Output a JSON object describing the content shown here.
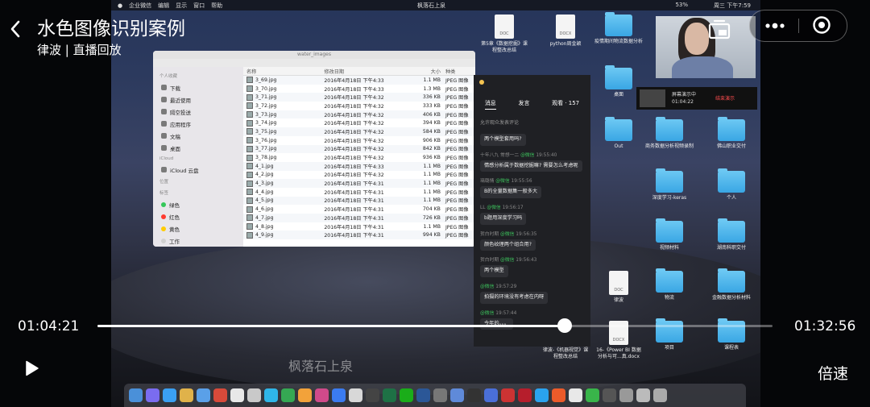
{
  "header": {
    "title": "水色图像识别案例",
    "subtitle": "律波 | 直播回放"
  },
  "player": {
    "current_time": "01:04:21",
    "total_time": "01:32:56",
    "progress": 0.692,
    "speed_label": "倍速"
  },
  "screen": {
    "menubar": {
      "items": [
        "企业微信",
        "编辑",
        "显示",
        "窗口",
        "帮助"
      ],
      "center": "枫落石上泉",
      "battery": "53%",
      "clock": "周三 下午7:59"
    },
    "finder": {
      "window_title": "water_images",
      "sidebar": {
        "favorites_title": "个人收藏",
        "favorites": [
          "下载",
          "最近使用",
          "隔空投送",
          "应用程序",
          "文稿",
          "桌面"
        ],
        "icloud_title": "iCloud",
        "icloud": [
          "iCloud 云盘"
        ],
        "locations_title": "位置",
        "tags_title": "标签",
        "tags": [
          {
            "name": "绿色",
            "color": "#34c759"
          },
          {
            "name": "红色",
            "color": "#ff3b30"
          },
          {
            "name": "黄色",
            "color": "#ffcc00"
          },
          {
            "name": "工作",
            "color": "#d0d0d0"
          }
        ]
      },
      "columns": [
        "名称",
        "修改日期",
        "大小",
        "种类"
      ],
      "rows": [
        [
          "3_69.jpg",
          "2016年4月18日 下午4:33",
          "1.1 MB",
          "JPEG 图像"
        ],
        [
          "3_70.jpg",
          "2016年4月18日 下午4:33",
          "1.3 MB",
          "JPEG 图像"
        ],
        [
          "3_71.jpg",
          "2016年4月18日 下午4:32",
          "336 KB",
          "JPEG 图像"
        ],
        [
          "3_72.jpg",
          "2016年4月18日 下午4:32",
          "333 KB",
          "JPEG 图像"
        ],
        [
          "3_73.jpg",
          "2016年4月18日 下午4:32",
          "406 KB",
          "JPEG 图像"
        ],
        [
          "3_74.jpg",
          "2016年4月18日 下午4:32",
          "394 KB",
          "JPEG 图像"
        ],
        [
          "3_75.jpg",
          "2016年4月18日 下午4:32",
          "584 KB",
          "JPEG 图像"
        ],
        [
          "3_76.jpg",
          "2016年4月18日 下午4:32",
          "906 KB",
          "JPEG 图像"
        ],
        [
          "3_77.jpg",
          "2016年4月18日 下午4:32",
          "842 KB",
          "JPEG 图像"
        ],
        [
          "3_78.jpg",
          "2016年4月18日 下午4:32",
          "936 KB",
          "JPEG 图像"
        ],
        [
          "4_1.jpg",
          "2016年4月18日 下午4:33",
          "1.1 MB",
          "JPEG 图像"
        ],
        [
          "4_2.jpg",
          "2016年4月18日 下午4:32",
          "1.1 MB",
          "JPEG 图像"
        ],
        [
          "4_3.jpg",
          "2016年4月18日 下午4:31",
          "1.1 MB",
          "JPEG 图像"
        ],
        [
          "4_4.jpg",
          "2016年4月18日 下午4:31",
          "1.1 MB",
          "JPEG 图像"
        ],
        [
          "4_5.jpg",
          "2016年4月18日 下午4:31",
          "1.1 MB",
          "JPEG 图像"
        ],
        [
          "4_6.jpg",
          "2016年4月18日 下午4:31",
          "704 KB",
          "JPEG 图像"
        ],
        [
          "4_7.jpg",
          "2016年4月18日 下午4:31",
          "726 KB",
          "JPEG 图像"
        ],
        [
          "4_8.jpg",
          "2016年4月18日 下午4:31",
          "1.1 MB",
          "JPEG 图像"
        ],
        [
          "4_9.jpg",
          "2016年4月18日 下午4:31",
          "994 KB",
          "JPEG 图像"
        ]
      ]
    },
    "chat": {
      "tabs": [
        "消息",
        "发言",
        "观看 · 157"
      ],
      "sort_label": "允许观众发表评论",
      "messages": [
        {
          "user": "",
          "time": "",
          "text": "两个模型套用吗?"
        },
        {
          "user": "十年八九 常想一二",
          "time": "19:55:40",
          "text": "情感分析属于数据挖掘嘛? 需要怎么考虑呢"
        },
        {
          "user": "璃璐情",
          "time": "19:55:56",
          "text": "B的全量数据集一般多大"
        },
        {
          "user": "LL",
          "time": "19:56:17",
          "text": "b题用深度学习吗"
        },
        {
          "user": "贺白时期",
          "time": "19:56:35",
          "text": "颜色纹理两个组合用?"
        },
        {
          "user": "贺白时期",
          "time": "19:56:43",
          "text": "两个模型"
        },
        {
          "user": "",
          "time": "19:57:29",
          "text": "拍摄的环境没有考虑在内呀"
        },
        {
          "user": "",
          "time": "19:57:44",
          "text": "今年的。。。"
        }
      ],
      "wechat_tag": "@微信"
    },
    "share_bar": {
      "label": "屏幕演示中",
      "time": "01:04:22",
      "stop": "结束演示"
    },
    "desktop_icons": [
      {
        "label": "第5章《数据挖掘》课程整改总结",
        "type": "doc",
        "kind": "DOC"
      },
      {
        "label": "python周金颖",
        "type": "doc",
        "kind": "DOCX"
      },
      {
        "label": "疫情期间物流数据分析",
        "type": "folder"
      },
      {
        "label": "桌面",
        "type": "folder"
      },
      {
        "label": "Out",
        "type": "folder"
      },
      {
        "label": "商务数据分析视频录制",
        "type": "folder"
      },
      {
        "label": "佛山职业交付",
        "type": "folder"
      },
      {
        "label": "深度学习-keras",
        "type": "folder"
      },
      {
        "label": "个人",
        "type": "folder"
      },
      {
        "label": "视频材料",
        "type": "folder"
      },
      {
        "label": "湖南科职交付",
        "type": "folder"
      },
      {
        "label": "律波",
        "type": "doc",
        "kind": "DOC"
      },
      {
        "label": "物流",
        "type": "folder"
      },
      {
        "label": "金融数据分析材料",
        "type": "folder"
      },
      {
        "label": "律波-《机器视觉》课程整改总结",
        "type": "doc",
        "kind": "DOCX"
      },
      {
        "label": "16-《Power BI 数据分析与可...真.docx",
        "type": "doc",
        "kind": "DOCX"
      },
      {
        "label": "项目",
        "type": "folder"
      },
      {
        "label": "课程表",
        "type": "folder"
      }
    ],
    "watermark": "枫落石上泉"
  }
}
